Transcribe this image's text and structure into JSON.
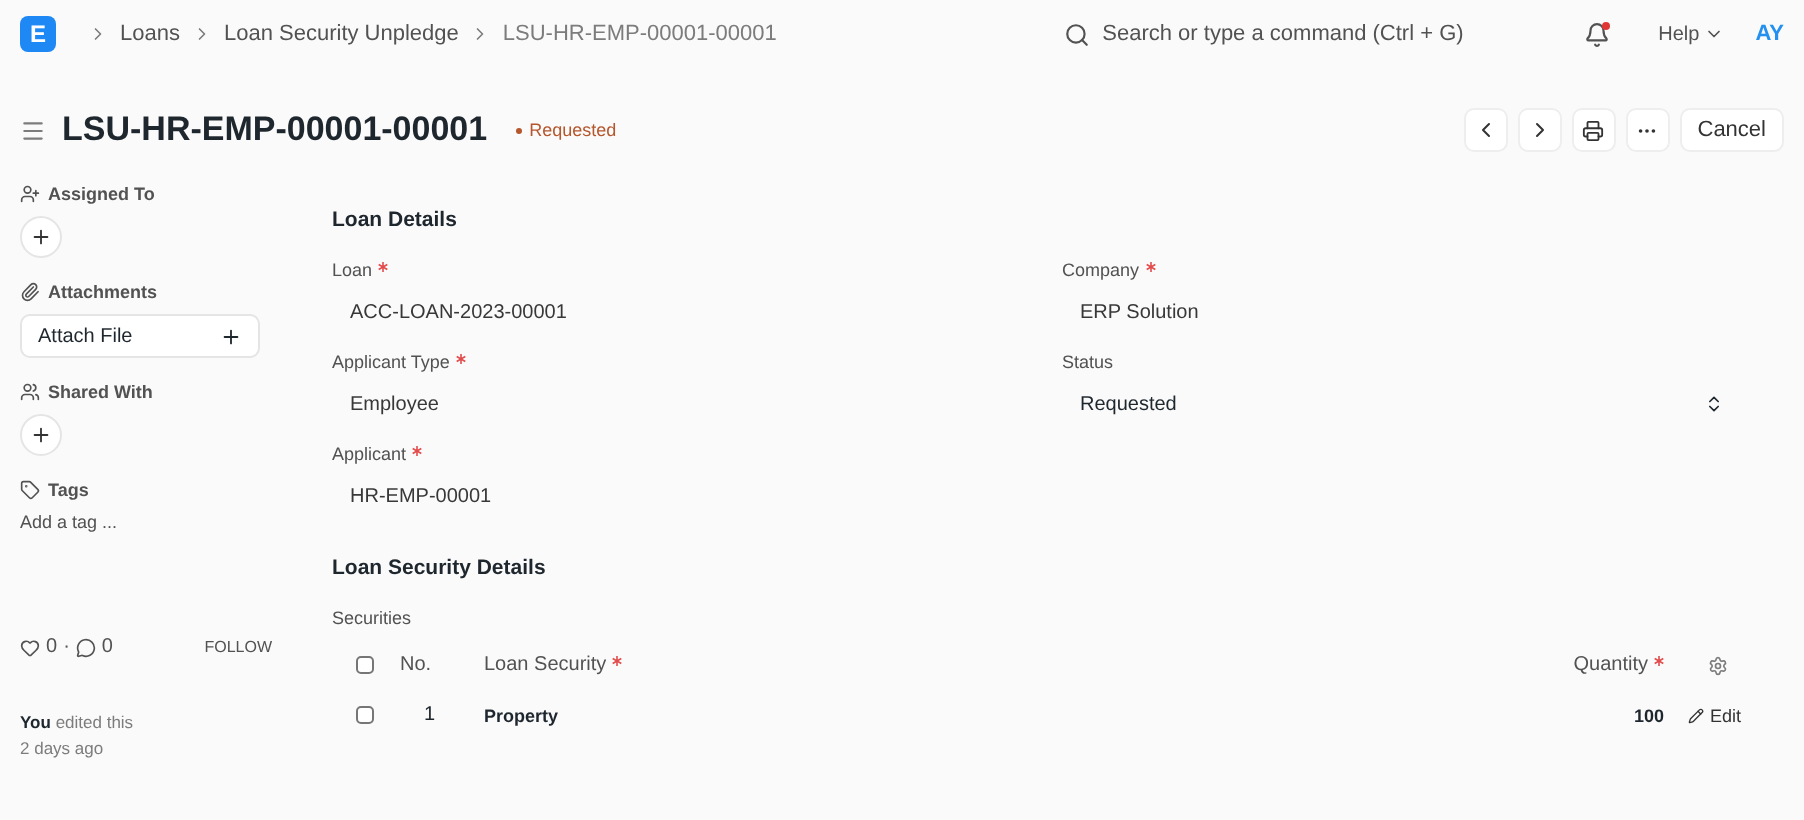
{
  "navbar": {
    "logo": "E",
    "breadcrumbs": [
      "Loans",
      "Loan Security Unpledge",
      "LSU-HR-EMP-00001-00001"
    ],
    "search": {
      "placeholder": "Search or type a command (Ctrl + G)"
    },
    "notifications_unread": true,
    "help": "Help",
    "avatar": "AY"
  },
  "header": {
    "title": "LSU-HR-EMP-00001-00001",
    "status": "Requested",
    "actions": [
      "Cancel"
    ]
  },
  "sidebar": {
    "assigned_to": "Assigned To",
    "attachments": "Attachments",
    "attach_button": "Attach File",
    "shared_with": "Shared With",
    "tags": "Tags",
    "add_tag": "Add a tag ...",
    "likes": "0",
    "separator": "·",
    "comments": "0",
    "follow": "FOLLOW",
    "activity_user": "You",
    "activity_text": "edited this",
    "activity_time": "2 days ago"
  },
  "sections": [
    {
      "title": "Loan Details",
      "fields": [
        {
          "label": "Loan",
          "required": true,
          "value": "ACC-LOAN-2023-00001",
          "kind": "link"
        },
        {
          "label": "Company",
          "required": true,
          "value": "ERP Solution",
          "kind": "link"
        },
        {
          "label": "Applicant Type",
          "required": true,
          "value": "Employee",
          "kind": "link"
        },
        {
          "label": "Status",
          "required": false,
          "value": "Requested",
          "kind": "select"
        },
        {
          "label": "Applicant",
          "required": true,
          "value": "HR-EMP-00001",
          "kind": "link"
        }
      ]
    }
  ],
  "securities": {
    "section_title": "Loan Security Details",
    "label": "Securities",
    "columns": [
      {
        "label": "No.",
        "required": false
      },
      {
        "label": "Loan Security",
        "required": true
      },
      {
        "label": "Quantity",
        "required": true
      }
    ],
    "rows": [
      {
        "no": "1",
        "loan_security": "Property",
        "quantity": "100",
        "checked": false,
        "edit": "Edit"
      }
    ],
    "all_checked": false
  }
}
